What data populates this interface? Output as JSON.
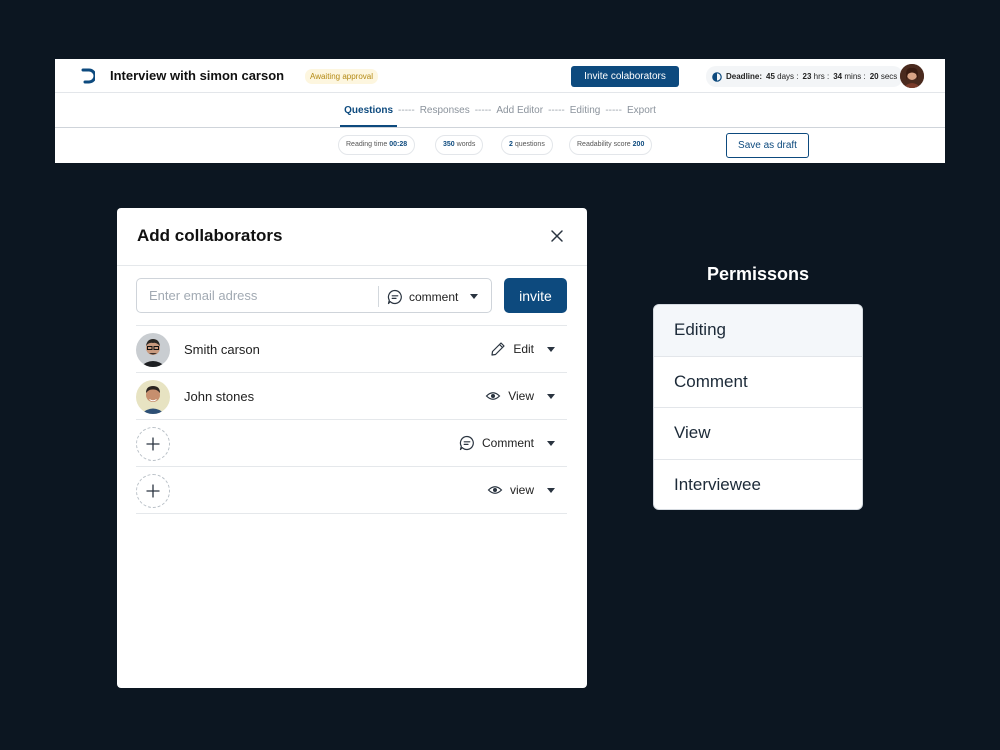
{
  "header": {
    "title": "Interview with simon carson",
    "status_badge": "Awaiting approval",
    "invite_button": "Invite colaborators",
    "deadline": {
      "label": "Deadline:",
      "days": "45",
      "days_unit": "days",
      "hrs": "23",
      "hrs_unit": "hrs",
      "mins": "34",
      "mins_unit": "mins",
      "secs": "20",
      "secs_unit": "secs"
    }
  },
  "steps": [
    {
      "label": "Questions",
      "active": true
    },
    {
      "label": "Responses"
    },
    {
      "label": "Add Editor"
    },
    {
      "label": "Editing"
    },
    {
      "label": "Export"
    }
  ],
  "step_separator": "-----",
  "stats": {
    "reading_time_label": "Reading time",
    "reading_time_value": "00:28",
    "words_value": "350",
    "words_label": "words",
    "questions_value": "2",
    "questions_label": "questions",
    "readability_label": "Readability score",
    "readability_value": "200"
  },
  "save_draft": "Save as draft",
  "modal": {
    "title": "Add collaborators",
    "email_placeholder": "Enter email adress",
    "email_value": "",
    "default_permission": "comment",
    "invite_button": "invite",
    "collaborators": [
      {
        "name": "Smith carson",
        "permission": "Edit",
        "permission_icon": "pencil-icon"
      },
      {
        "name": "John stones",
        "permission": "View",
        "permission_icon": "eye-icon"
      },
      {
        "name": "",
        "permission": "Comment",
        "permission_icon": "comment-icon"
      },
      {
        "name": "",
        "permission": "view",
        "permission_icon": "eye-icon"
      }
    ]
  },
  "permissions": {
    "heading": "Permissons",
    "items": [
      "Editing",
      "Comment",
      "View",
      "Interviewee"
    ]
  },
  "colors": {
    "background": "#0c1621",
    "primary": "#0d4a7e",
    "badge_bg": "#fdf6df",
    "badge_text": "#b48a14"
  }
}
